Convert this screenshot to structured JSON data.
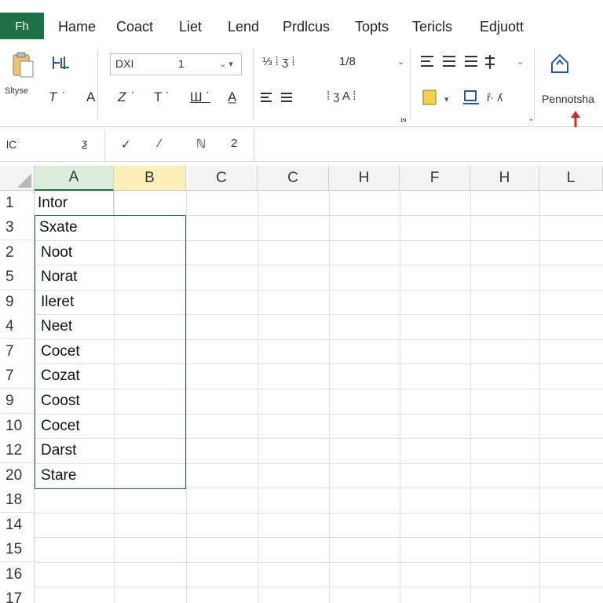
{
  "colors": {
    "file_tab": "#1e7145",
    "selection_border": "#2e6b4f",
    "header_selected": "#dcecdc",
    "header_b": "#fbeeb8",
    "red_arrow": "#d22828"
  },
  "ribbon_tabs": {
    "file": "Fh",
    "tabs": [
      "Hame",
      "Coact",
      "Liet",
      "Lend",
      "Prdlcus",
      "Topts",
      "Tericls",
      "Edjuott"
    ]
  },
  "ribbon": {
    "paste_label": "Sltyse",
    "font_name": "DXI",
    "font_size": "1",
    "number_format": "1/8",
    "group_labels": {
      "font_dialog": "ɪɴ"
    },
    "right_label": "Pennotsha",
    "icons": [
      "clipboard-icon",
      "format-painter-icon",
      "bold-icon",
      "italic-icon",
      "underline-icon",
      "font-color-icon",
      "align-left-icon",
      "align-center-icon",
      "wrap-text-icon",
      "merge-icon",
      "fill-color-icon",
      "borders-icon",
      "clear-icon",
      "share-icon",
      "red-arrow-icon"
    ]
  },
  "formula_bar": {
    "name_box": "lC",
    "controls": [
      "ℕ",
      "2"
    ],
    "value": ""
  },
  "grid": {
    "columns": [
      "A",
      "B",
      "C",
      "C",
      "H",
      "F",
      "H",
      "L"
    ],
    "selected_column": "A",
    "row_numbers": [
      "1",
      "3",
      "2",
      "5",
      "9",
      "4",
      "7",
      "7",
      "9",
      "10",
      "12",
      "20",
      "18",
      "14",
      "15",
      "16",
      "17"
    ],
    "cells_a": [
      "Intor",
      "Sxate",
      "Noot",
      "Norat",
      "Ileret",
      "Neet",
      "Cocet",
      "Cozat",
      "Coost",
      "Cocet",
      "Darst",
      "Stare"
    ]
  }
}
